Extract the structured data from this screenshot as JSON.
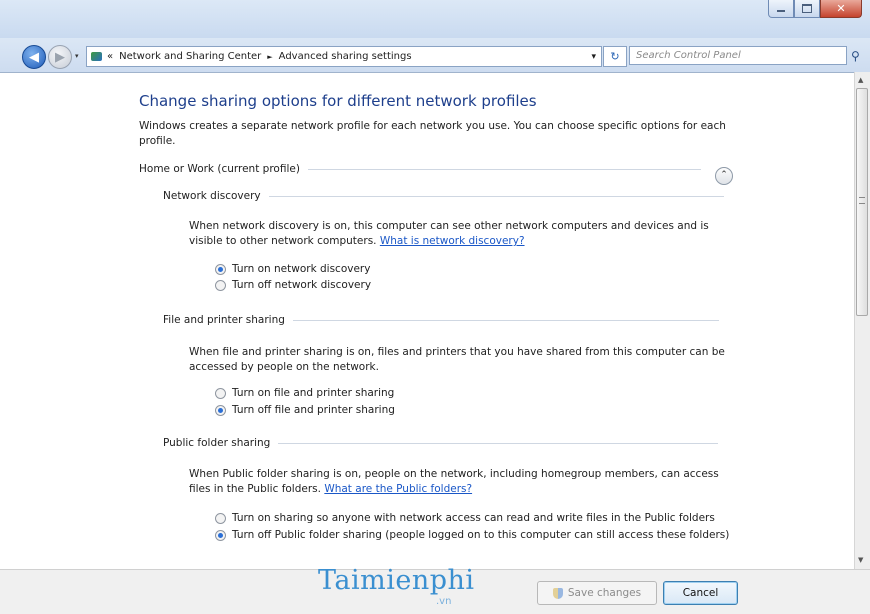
{
  "address": {
    "breadcrumb_prefix": "«",
    "segments": [
      "Network and Sharing Center",
      "Advanced sharing settings"
    ],
    "separator": "►",
    "dropdown_glyph": "▾",
    "refresh_glyph": "↻"
  },
  "search": {
    "placeholder": "Search Control Panel"
  },
  "page": {
    "title": "Change sharing options for different network profiles",
    "intro": "Windows creates a separate network profile for each network you use. You can choose specific options for each profile."
  },
  "profile": {
    "label": "Home or Work (current profile)",
    "collapse_glyph": "⌃"
  },
  "network_discovery": {
    "heading": "Network discovery",
    "description": "When network discovery is on, this computer can see other network computers and devices and is visible to other network computers.",
    "link": "What is network discovery?",
    "options": [
      {
        "label": "Turn on network discovery",
        "selected": true
      },
      {
        "label": "Turn off network discovery",
        "selected": false
      }
    ]
  },
  "file_printer": {
    "heading": "File and printer sharing",
    "description": "When file and printer sharing is on, files and printers that you have shared from this computer can be accessed by people on the network.",
    "options": [
      {
        "label": "Turn on file and printer sharing",
        "selected": false
      },
      {
        "label": "Turn off file and printer sharing",
        "selected": true
      }
    ]
  },
  "public_folder": {
    "heading": "Public folder sharing",
    "description": "When Public folder sharing is on, people on the network, including homegroup members, can access files in the Public folders.",
    "link": "What are the Public folders?",
    "options": [
      {
        "label": "Turn on sharing so anyone with network access can read and write files in the Public folders",
        "selected": false
      },
      {
        "label": "Turn off Public folder sharing (people logged on to this computer can still access these folders)",
        "selected": true
      }
    ]
  },
  "footer": {
    "brand": "Taimienphi",
    "brand_suffix": ".vn",
    "save_label": "Save changes",
    "cancel_label": "Cancel"
  }
}
